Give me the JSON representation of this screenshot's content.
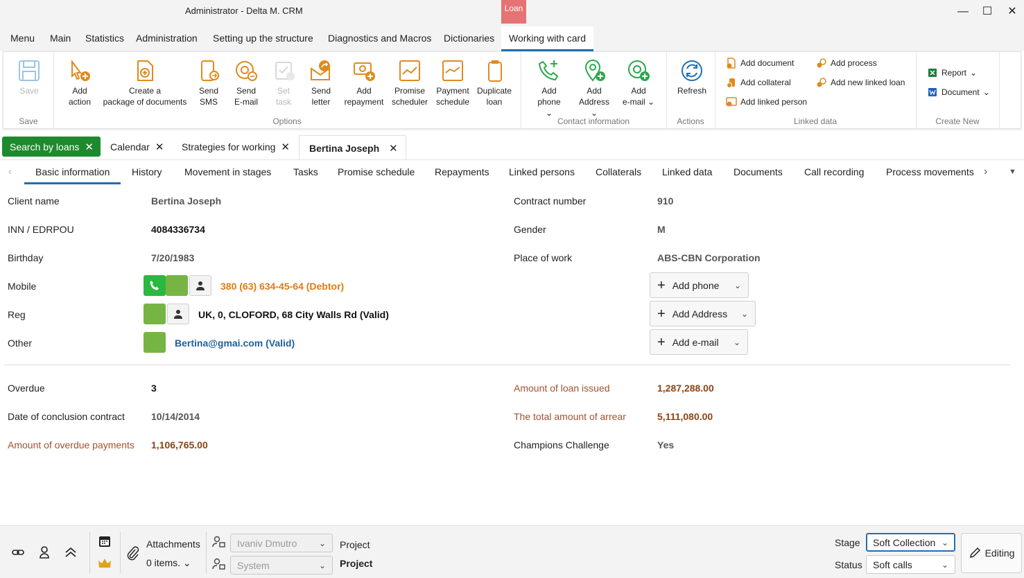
{
  "window": {
    "title": "Administrator - Delta M. CRM",
    "context_tag": "Loan",
    "controls": {
      "minimize": "—",
      "maximize": "☐",
      "close": "✕"
    }
  },
  "menu": {
    "items": [
      "Menu",
      "Main",
      "Statistics",
      "Administration",
      "Setting up the structure",
      "Diagnostics and Macros",
      "Dictionaries",
      "Working with card"
    ]
  },
  "ribbon": {
    "save_group": {
      "save_label": "Save",
      "group_label": "Save"
    },
    "options": {
      "group_label": "Options",
      "add_action": [
        "Add",
        "action"
      ],
      "create_package": [
        "Create a",
        "package of documents"
      ],
      "send_sms": [
        "Send",
        "SMS"
      ],
      "send_email": [
        "Send",
        "E-mail"
      ],
      "set_task": [
        "Set",
        "task"
      ],
      "send_letter": [
        "Send",
        "letter"
      ],
      "add_repayment": [
        "Add",
        "repayment"
      ],
      "promise_scheduler": [
        "Promise",
        "scheduler"
      ],
      "payment_schedule": [
        "Payment",
        "schedule"
      ],
      "duplicate_loan": [
        "Duplicate",
        "loan"
      ]
    },
    "contact": {
      "group_label": "Contact information",
      "add_phone": [
        "Add",
        "phone"
      ],
      "add_address": [
        "Add",
        "Address"
      ],
      "add_email": [
        "Add",
        "e-mail"
      ]
    },
    "actions": {
      "group_label": "Actions",
      "refresh": "Refresh"
    },
    "linked": {
      "group_label": "Linked data",
      "add_document": "Add document",
      "add_collateral": "Add collateral",
      "add_linked_person": "Add linked person",
      "add_process": "Add process",
      "add_new_linked_loan": "Add new linked loan"
    },
    "create_new": {
      "group_label": "Create New",
      "report": "Report",
      "document": "Document"
    }
  },
  "doc_tabs": {
    "search": "Search by loans",
    "calendar": "Calendar",
    "strategies": "Strategies for working",
    "current": "Bertina Joseph",
    "close_glyph": "✕"
  },
  "section_tabs": [
    "Basic information",
    "History",
    "Movement in stages",
    "Tasks",
    "Promise schedule",
    "Repayments",
    "Linked persons",
    "Collaterals",
    "Linked data",
    "Documents",
    "Call recording",
    "Process movements"
  ],
  "client": {
    "client_name_label": "Client name",
    "client_name": "Bertina Joseph",
    "inn_label": "INN / EDRPOU",
    "inn": "4084336734",
    "birthday_label": "Birthday",
    "birthday": "7/20/1983",
    "mobile_label": "Mobile",
    "mobile": "380 (63) 634-45-64 (Debtor)",
    "reg_label": "Reg",
    "reg": "UK, 0, CLOFORD, 68 City Walls Rd (Valid)",
    "other_label": "Other",
    "other": "Bertina@gmai.com (Valid)",
    "contract_number_label": "Contract number",
    "contract_number": "910",
    "gender_label": "Gender",
    "gender": "M",
    "place_of_work_label": "Place of work",
    "place_of_work": "ABS-CBN Corporation",
    "add_phone": "Add phone",
    "add_address": "Add Address",
    "add_email": "Add e-mail"
  },
  "loan": {
    "overdue_label": "Overdue",
    "overdue": "3",
    "date_conclusion_label": "Date of conclusion  contract",
    "date_conclusion": "10/14/2014",
    "amount_overdue_label": "Amount of overdue payments",
    "amount_overdue": "1,106,765.00",
    "amount_issued_label": "Amount of loan issued",
    "amount_issued": "1,287,288.00",
    "total_arrear_label": "The total amount of arrear",
    "total_arrear": "5,111,080.00",
    "champions_label": "Champions Challenge",
    "champions": "Yes"
  },
  "bottom": {
    "attachments_label": "Attachments",
    "attachments_count": "0 items.",
    "user_combo": "Ivaniv Dmutro",
    "system_combo": "System",
    "project_label": "Project",
    "project_value": "Project",
    "stage_label": "Stage",
    "stage_value": "Soft Collection",
    "status_label": "Status",
    "status_value": "Soft calls",
    "editing": "Editing"
  },
  "colors": {
    "accent_blue": "#1f6fb5",
    "ribbon_orange": "#e08a1e",
    "ribbon_green": "#2aa84a",
    "tab_green": "#1e8a2e",
    "loan_tag": "#e57373",
    "phone_green": "#2ab840",
    "contact_green": "#76b544"
  }
}
